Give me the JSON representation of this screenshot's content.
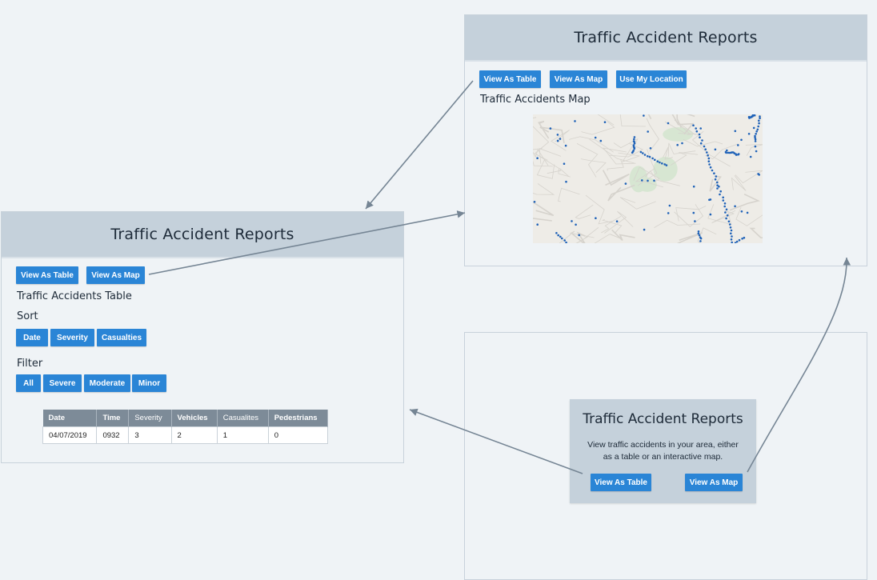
{
  "table_view": {
    "title": "Traffic Accident Reports",
    "buttons": {
      "table": "View As Table",
      "map": "View As Map"
    },
    "heading": "Traffic Accidents Table",
    "sort": {
      "label": "Sort",
      "buttons": [
        "Date",
        "Severity",
        "Casualties"
      ]
    },
    "filter": {
      "label": "Filter",
      "buttons": [
        "All",
        "Severe",
        "Moderate",
        "Minor"
      ]
    },
    "table": {
      "columns": [
        "Date",
        "Time",
        "Severity",
        "Vehicles",
        "Casualites",
        "Pedestrians"
      ],
      "rows": [
        [
          "04/07/2019",
          "0932",
          "3",
          "2",
          "1",
          "0"
        ]
      ]
    }
  },
  "map_view": {
    "title": "Traffic Accident Reports",
    "buttons": {
      "table": "View As Table",
      "map": "View As Map",
      "location": "Use My Location"
    },
    "heading": "Traffic Accidents Map",
    "map_colors": {
      "background": "#eeece7",
      "roads": "#d6d3cd",
      "parks": "#d7e6d2",
      "markers": "#1f62b8"
    }
  },
  "landing_view": {
    "title": "Traffic Accident Reports",
    "description_line1": "View traffic accidents in your area, either",
    "description_line2": "as a table or an interactive map.",
    "buttons": {
      "table": "View As Table",
      "map": "View As Map"
    }
  },
  "colors": {
    "accent": "#2a85d6",
    "header": "#c5d1db",
    "background": "#eff3f6",
    "arrow": "#758594"
  }
}
